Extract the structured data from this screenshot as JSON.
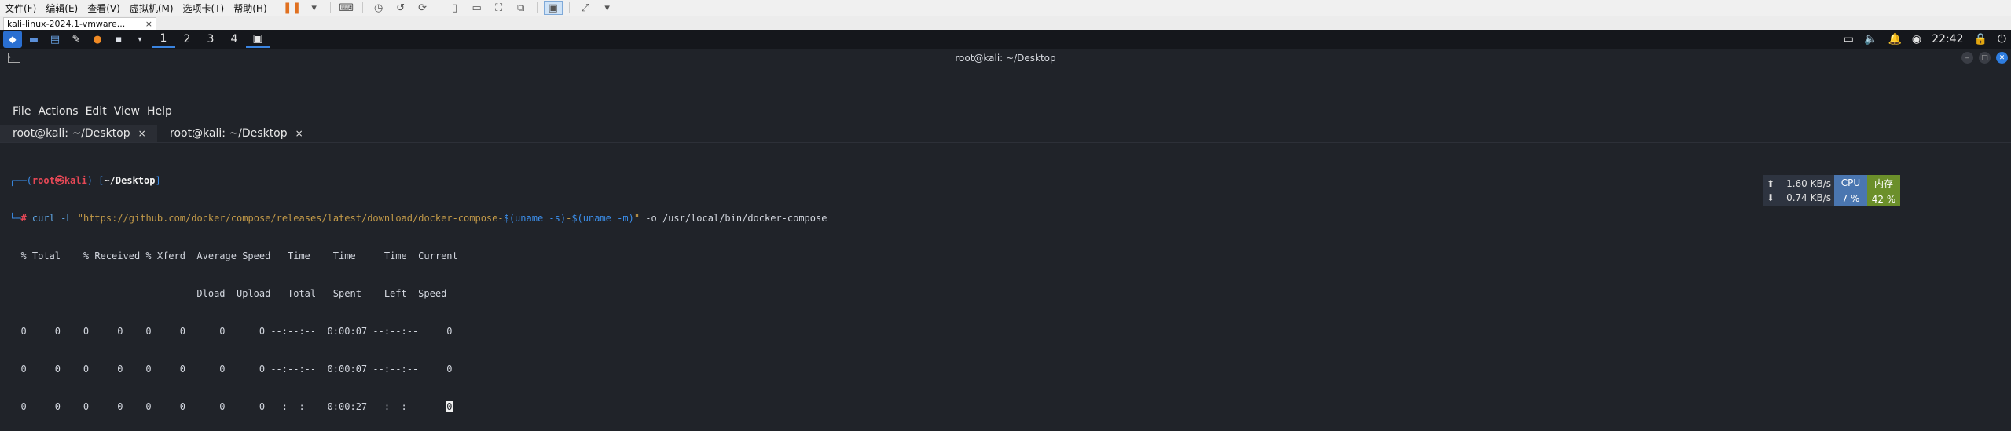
{
  "vmware": {
    "menus": [
      "文件(F)",
      "编辑(E)",
      "查看(V)",
      "虚拟机(M)",
      "选项卡(T)",
      "帮助(H)"
    ],
    "tab_title": "kali-linux-2024.1-vmware...",
    "tab_close": "×"
  },
  "panel": {
    "workspaces": [
      "1",
      "2",
      "3",
      "4"
    ],
    "clock": "22:42"
  },
  "terminal": {
    "window_title": "root@kali: ~/Desktop",
    "menus": [
      "File",
      "Actions",
      "Edit",
      "View",
      "Help"
    ],
    "tabs": [
      {
        "label": "root@kali: ~/Desktop",
        "close": "×"
      },
      {
        "label": "root@kali: ~/Desktop",
        "close": "×"
      }
    ],
    "prompt": {
      "user": "root",
      "host": "kali",
      "path": "~/Desktop",
      "symbol": "#"
    },
    "command": {
      "cmd": "curl",
      "opt": "-L",
      "url_start": "\"https://github.com/docker/compose/releases/latest/download/docker-compose-",
      "sub1": "$(uname -s)",
      "dash": "-",
      "sub2": "$(uname -m)",
      "url_end": "\"",
      "rest": " -o /usr/local/bin/docker-compose"
    },
    "output_lines": [
      "  % Total    % Received % Xferd  Average Speed   Time    Time     Time  Current",
      "                                 Dload  Upload   Total   Spent    Left  Speed",
      "  0     0    0     0    0     0      0      0 --:--:--  0:00:07 --:--:--     0",
      "  0     0    0     0    0     0      0      0 --:--:--  0:00:07 --:--:--     0",
      "  0     0    0     0    0     0      0      0 --:--:--  0:00:27 --:--:--     "
    ],
    "cursor_char": "0"
  },
  "widget": {
    "up_speed": "1.60 KB/s",
    "down_speed": "0.74 KB/s",
    "cpu_label": "CPU",
    "cpu_value": "7 %",
    "mem_label": "内存",
    "mem_value": "42 %"
  },
  "colors": {
    "terminal_bg": "#202329",
    "prompt_blue": "#3b8eea",
    "prompt_red": "#e74856",
    "accent": "#2e7de0"
  }
}
